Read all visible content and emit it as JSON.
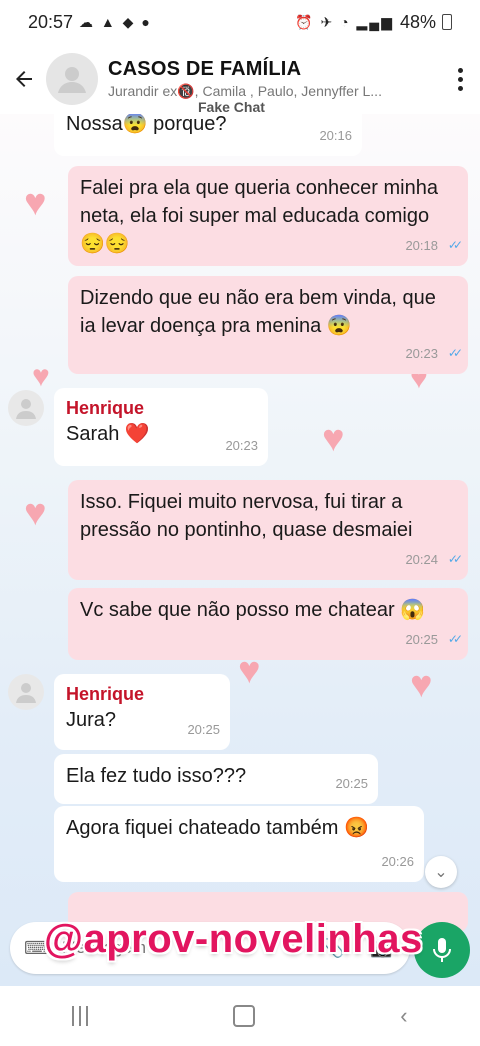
{
  "status": {
    "time": "20:57",
    "battery": "48%"
  },
  "header": {
    "title": "CASOS DE FAMÍLIA",
    "members": "Jurandir ex🔞, Camila , Paulo, Jennyffer L...",
    "watermark": "Fake Chat"
  },
  "messages": [
    {
      "dir": "in",
      "text": "Nossa😨 porque?",
      "time": "20:16"
    },
    {
      "dir": "out",
      "text": "Falei pra ela que queria conhecer minha neta, ela foi super mal educada comigo 😔😔",
      "time": "20:18"
    },
    {
      "dir": "out",
      "text": "Dizendo que eu não era bem vinda, que ia levar doença pra menina 😨",
      "time": "20:23"
    },
    {
      "dir": "in",
      "sender": "Henrique",
      "text": "Sarah ❤️",
      "time": "20:23"
    },
    {
      "dir": "out",
      "text": "Isso.  Fiquei muito nervosa, fui tirar a pressão no pontinho,  quase desmaiei",
      "time": "20:24"
    },
    {
      "dir": "out",
      "text": "Vc sabe que não posso me chatear 😱",
      "time": "20:25"
    },
    {
      "dir": "in",
      "sender": "Henrique",
      "text": "Jura?",
      "time": "20:25"
    },
    {
      "dir": "in",
      "text": "Ela fez tudo isso???",
      "time": "20:25"
    },
    {
      "dir": "in",
      "text": "Agora fiquei chateado também 😡",
      "time": "20:26"
    }
  ],
  "input": {
    "placeholder": "Mensagem"
  },
  "overlay": {
    "text": "@aprov-novelinhas"
  },
  "colors": {
    "outgoing_bubble": "#fcdde3",
    "incoming_bubble": "#ffffff",
    "sender_name": "#c4142a",
    "mic_button": "#1aa566",
    "overlay_text": "#e2155f"
  }
}
